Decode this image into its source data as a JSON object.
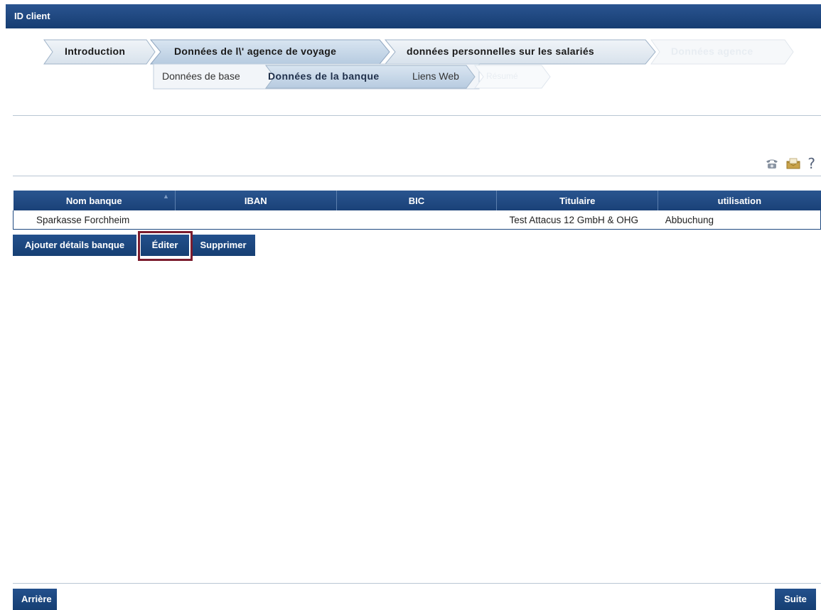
{
  "window": {
    "title": "ID client"
  },
  "steps": [
    {
      "label": "Introduction",
      "state": "done"
    },
    {
      "label": "Données de l\\' agence de voyage",
      "state": "current"
    },
    {
      "label": "données personnelles sur les salariés",
      "state": "upcoming"
    },
    {
      "label": "Données agence",
      "state": "disabled"
    }
  ],
  "substeps": [
    {
      "label": "Données de base",
      "state": "done"
    },
    {
      "label": "Données de la banque",
      "state": "current"
    },
    {
      "label": "Liens Web",
      "state": "upcoming"
    },
    {
      "label": "Résumé",
      "state": "disabled"
    }
  ],
  "toolbar_icons": [
    "phone-icon",
    "mail-icon",
    "help-icon"
  ],
  "help_glyph": "?",
  "table": {
    "columns": [
      "Nom banque",
      "IBAN",
      "BIC",
      "Titulaire",
      "utilisation"
    ],
    "sort_indicator": "▲",
    "rows": [
      [
        "Sparkasse Forchheim",
        "",
        "",
        "Test Attacus 12 GmbH & OHG",
        "Abbuchung"
      ]
    ]
  },
  "actions": {
    "add": "Ajouter détails banque",
    "edit": "Éditer",
    "delete": "Supprimer"
  },
  "nav": {
    "back": "Arrière",
    "next": "Suite"
  },
  "colors": {
    "header": "#1f4a82",
    "highlight": "#7b1c2e",
    "step_fill": "#dfe8f1",
    "step_current": "#c5d6e8"
  }
}
